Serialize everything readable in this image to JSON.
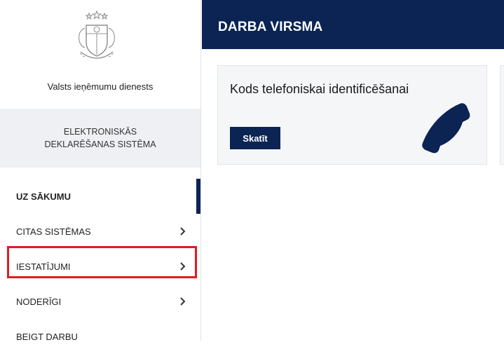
{
  "sidebar": {
    "org_name": "Valsts ieņēmumu dienests",
    "system_name": "ELEKTRONISKĀS\nDEKLARĒŠANAS SISTĒMA",
    "menu": [
      {
        "label": "UZ SĀKUMU",
        "has_arrow": false,
        "active": true
      },
      {
        "label": "CITAS SISTĒMAS",
        "has_arrow": true
      },
      {
        "label": "IESTATĪJUMI",
        "has_arrow": true,
        "highlighted": true
      },
      {
        "label": "NODERĪGI",
        "has_arrow": true
      },
      {
        "label": "BEIGT DARBU",
        "has_arrow": false
      }
    ]
  },
  "header": {
    "title": "DARBA VIRSMA"
  },
  "cards": [
    {
      "title": "Kods telefoniskai identificēšanai",
      "button_label": "Skatīt",
      "icon": "phone-icon"
    }
  ],
  "colors": {
    "navy": "#0b2454",
    "highlight_red": "#e01b22",
    "system_box_bg": "#eef0f3",
    "card_bg": "#f5f6f8"
  }
}
